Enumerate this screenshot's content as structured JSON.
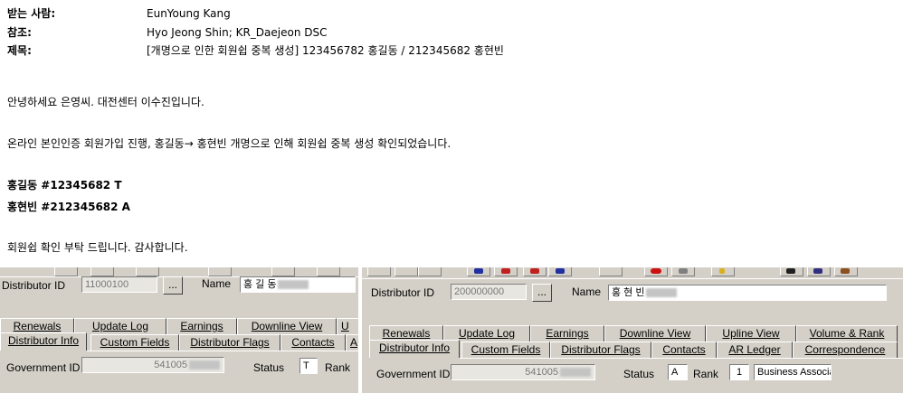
{
  "email": {
    "to_label": "받는 사람:",
    "to_value": "EunYoung Kang",
    "cc_label": "참조:",
    "cc_value": "Hyo Jeong Shin; KR_Daejeon DSC",
    "subject_label": "제목:",
    "subject_value": "[개명으로 인한 회원쉽 중복 생성] 123456782 홍길동 / 212345682 홍현빈",
    "greeting": "안녕하세요 은영씨. 대전센터 이수진입니다.",
    "line1": "온라인 본인인증 회원가입 진행, 홍길동→ 홍현빈 개명으로 인해 회원쉽 중복 생성 확인되었습니다.",
    "member1": "홍길동 #12345682 T",
    "member2": "홍현빈 #212345682 A",
    "closing": "회원쉽 확인 부탁 드립니다. 감사합니다."
  },
  "left_pane": {
    "distributor_id_label": "Distributor ID",
    "distributor_id_value": "11000100",
    "browse_label": "...",
    "name_label": "Name",
    "name_value": "홍 길 동",
    "tabs_row1": [
      "Renewals",
      "Update Log",
      "Earnings",
      "Downline View",
      "U"
    ],
    "tabs_row2": [
      "Distributor Info",
      "Custom Fields",
      "Distributor Flags",
      "Contacts",
      "A"
    ],
    "government_id_label": "Government ID",
    "government_id_value": "541005",
    "status_label": "Status",
    "status_value": "T",
    "rank_label": "Rank"
  },
  "right_pane": {
    "distributor_id_label": "Distributor ID",
    "distributor_id_value": "200000000",
    "browse_label": "...",
    "name_label": "Name",
    "name_value": "홍 현 빈",
    "tabs_row1": [
      "Renewals",
      "Update Log",
      "Earnings",
      "Downline View",
      "Upline View",
      "Volume & Rank"
    ],
    "tabs_row2": [
      "Distributor Info",
      "Custom Fields",
      "Distributor Flags",
      "Contacts",
      "AR Ledger",
      "Correspondence"
    ],
    "government_id_label": "Government ID",
    "government_id_value": "541005",
    "status_label": "Status",
    "status_value": "A",
    "rank_label": "Rank",
    "rank_value": "1",
    "rank_name": "Business Associa"
  }
}
